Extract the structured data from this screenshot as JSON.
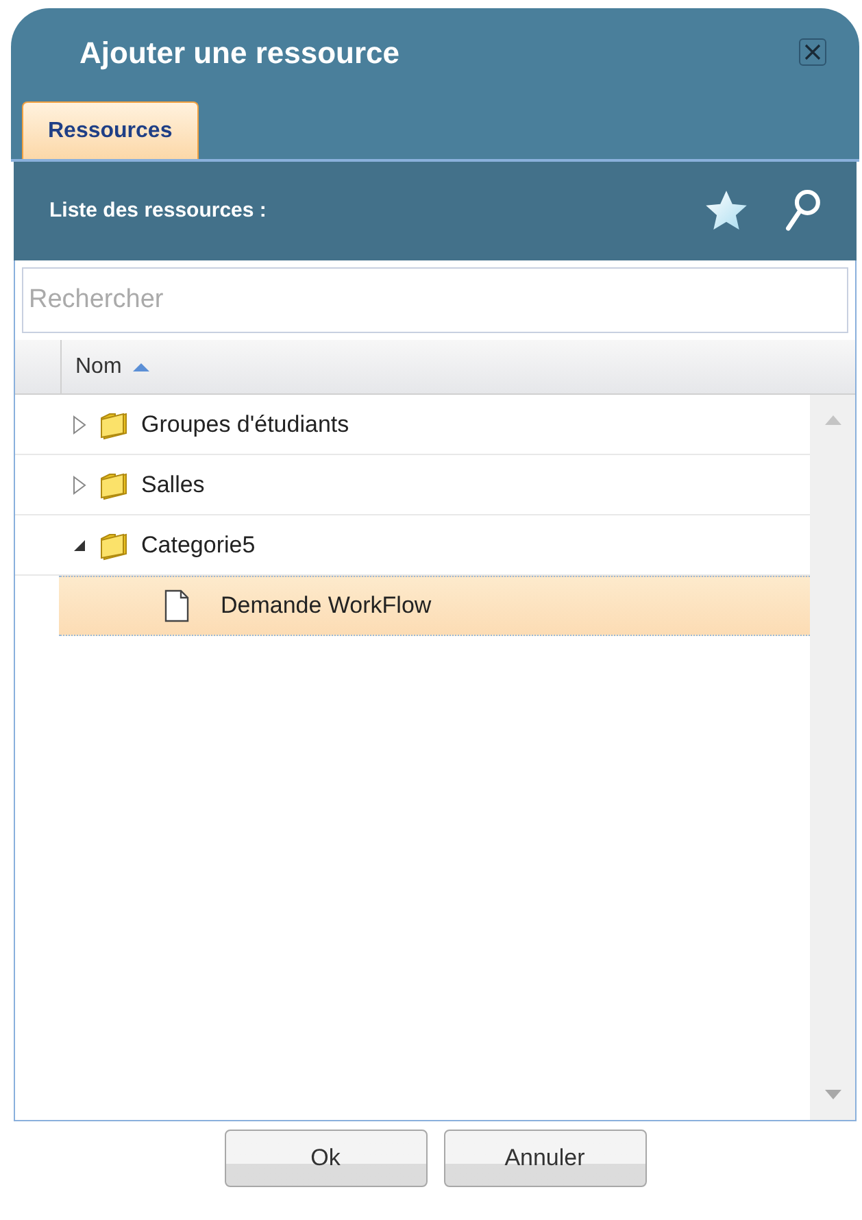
{
  "window": {
    "title": "Ajouter une ressource"
  },
  "tabs": [
    {
      "label": "Ressources",
      "selected": true
    }
  ],
  "toolbar": {
    "title": "Liste des ressources :"
  },
  "search": {
    "placeholder": "Rechercher"
  },
  "table": {
    "columns": [
      {
        "label": "Nom",
        "sort_ascending": true
      }
    ],
    "rows": [
      {
        "kind": "folder",
        "label": "Groupes d'étudiants",
        "expanded": false,
        "selected": false
      },
      {
        "kind": "folder",
        "label": "Salles",
        "expanded": false,
        "selected": false
      },
      {
        "kind": "folder",
        "label": "Categorie5",
        "expanded": true,
        "selected": false,
        "children": [
          {
            "kind": "file",
            "label": "Demande WorkFlow",
            "selected": true
          }
        ]
      }
    ]
  },
  "buttons": [
    "Ok",
    "Annuler"
  ]
}
